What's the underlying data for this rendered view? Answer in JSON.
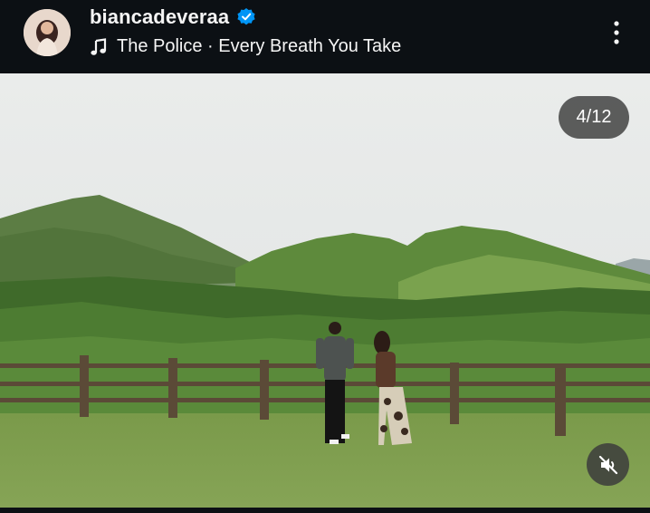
{
  "header": {
    "username": "biancadeveraa",
    "verified": true,
    "song": "The Police · Every Breath You Take",
    "icons": {
      "avatar": "profile-avatar",
      "verified": "verified-badge-icon",
      "music": "music-note-icon",
      "more": "more-options-icon"
    }
  },
  "post": {
    "image_index": "4/12",
    "media_kind": "landscape-photo",
    "audio_state": "muted"
  },
  "colors": {
    "header_bg": "#0c1014",
    "verified_blue": "#0095f6",
    "overlay_bg": "#3c3c3c"
  }
}
